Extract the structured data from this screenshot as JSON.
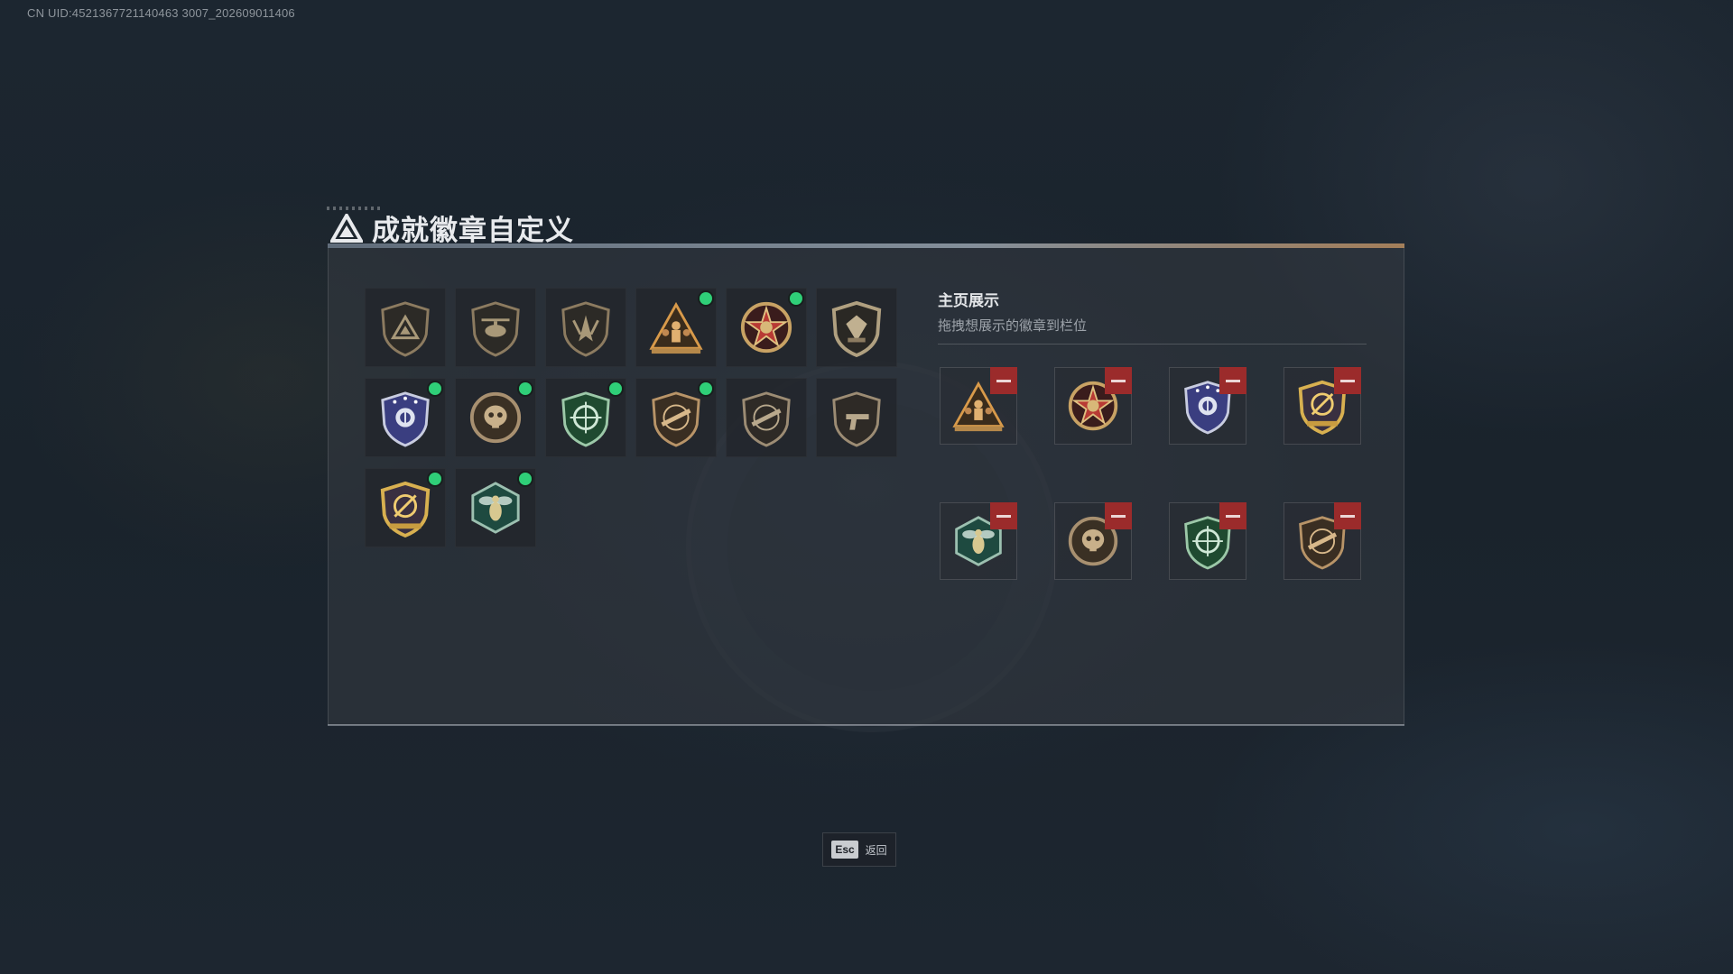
{
  "uid_text": "CN UID:4521367721140463 3007_202609011406",
  "title": "成就徽章自定义",
  "showcase": {
    "heading": "主页展示",
    "hint": "拖拽想展示的徽章到栏位"
  },
  "esc": {
    "key": "Esc",
    "label": "返回"
  },
  "colors": {
    "equipped_dot": "#2fcf78",
    "remove_button": "#9b2b2b"
  },
  "badges": [
    {
      "icon": "triangle-logo-badge-icon",
      "equipped": false
    },
    {
      "icon": "helicopter-badge-icon",
      "equipped": false
    },
    {
      "icon": "wings-shield-badge-icon",
      "equipped": false
    },
    {
      "icon": "soldiers-triangle-badge-icon",
      "equipped": true
    },
    {
      "icon": "star-medal-badge-icon",
      "equipped": true
    },
    {
      "icon": "emblem-shield-badge-icon",
      "equipped": false
    },
    {
      "icon": "police-shield-badge-icon",
      "equipped": true
    },
    {
      "icon": "skull-round-badge-icon",
      "equipped": true
    },
    {
      "icon": "green-crosshair-badge-icon",
      "equipped": true
    },
    {
      "icon": "rifle-shield-badge-icon",
      "equipped": true
    },
    {
      "icon": "rifle-shield-dark-badge-icon",
      "equipped": false
    },
    {
      "icon": "pistol-shield-badge-icon",
      "equipped": false
    },
    {
      "icon": "gold-crosshair-badge-icon",
      "equipped": true
    },
    {
      "icon": "hornet-hexagon-badge-icon",
      "equipped": true
    }
  ],
  "showcase_slots": [
    {
      "icon": "soldiers-triangle-badge-icon"
    },
    {
      "icon": "star-medal-badge-icon"
    },
    {
      "icon": "police-shield-badge-icon"
    },
    {
      "icon": "gold-crosshair-badge-icon"
    },
    {
      "icon": "hornet-hexagon-badge-icon"
    },
    {
      "icon": "skull-round-badge-icon"
    },
    {
      "icon": "green-crosshair-badge-icon"
    },
    {
      "icon": "rifle-shield-badge-icon"
    }
  ]
}
